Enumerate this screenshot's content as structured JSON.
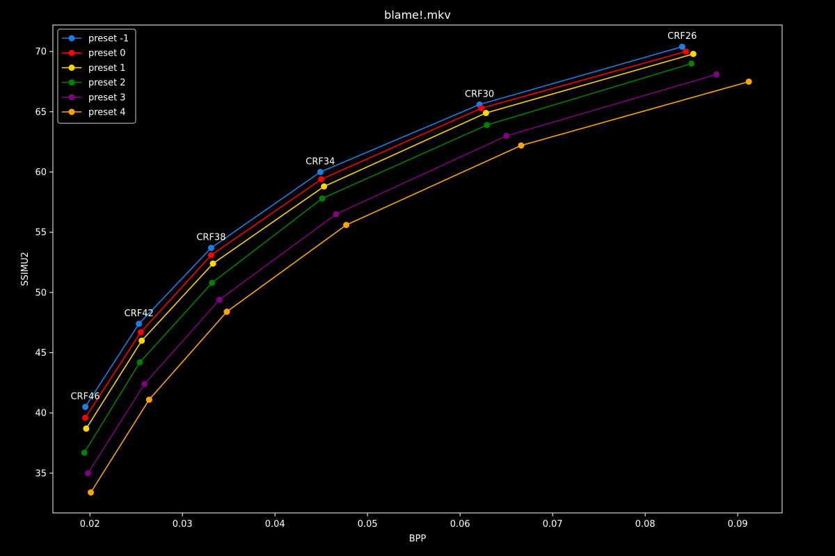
{
  "chart_data": {
    "type": "line",
    "title": "blame!.mkv",
    "xlabel": "BPP",
    "ylabel": "SSIMU2",
    "xlim": [
      0.016,
      0.0948
    ],
    "ylim": [
      31.7,
      72.2
    ],
    "xticks": [
      0.02,
      0.03,
      0.04,
      0.05,
      0.06,
      0.07,
      0.08,
      0.09
    ],
    "yticks": [
      35,
      40,
      45,
      50,
      55,
      60,
      65,
      70
    ],
    "grid": false,
    "legend_position": "top-left",
    "series": [
      {
        "name": "preset -1",
        "color": "#1a80e6",
        "points": [
          [
            0.0195,
            40.5
          ],
          [
            0.0253,
            47.4
          ],
          [
            0.0331,
            53.7
          ],
          [
            0.0449,
            60.0
          ],
          [
            0.0621,
            65.6
          ],
          [
            0.084,
            70.4
          ]
        ]
      },
      {
        "name": "preset 0",
        "color": "#ff0000",
        "points": [
          [
            0.0195,
            39.6
          ],
          [
            0.0255,
            46.7
          ],
          [
            0.0331,
            53.1
          ],
          [
            0.045,
            59.4
          ],
          [
            0.0623,
            65.3
          ],
          [
            0.0844,
            70.0
          ]
        ]
      },
      {
        "name": "preset 1",
        "color": "#ffd700",
        "points": [
          [
            0.0196,
            38.7
          ],
          [
            0.0256,
            46.0
          ],
          [
            0.0333,
            52.4
          ],
          [
            0.0453,
            58.8
          ],
          [
            0.0628,
            64.9
          ],
          [
            0.0852,
            69.8
          ]
        ]
      },
      {
        "name": "preset 2",
        "color": "#008000",
        "points": [
          [
            0.0194,
            36.7
          ],
          [
            0.0254,
            44.2
          ],
          [
            0.0332,
            50.8
          ],
          [
            0.0451,
            57.8
          ],
          [
            0.0629,
            63.9
          ],
          [
            0.085,
            69.0
          ]
        ]
      },
      {
        "name": "preset 3",
        "color": "#800080",
        "points": [
          [
            0.0198,
            35.0
          ],
          [
            0.0259,
            42.4
          ],
          [
            0.034,
            49.4
          ],
          [
            0.0466,
            56.5
          ],
          [
            0.065,
            63.0
          ],
          [
            0.0877,
            68.1
          ]
        ]
      },
      {
        "name": "preset 4",
        "color": "#ffa500",
        "points": [
          [
            0.0201,
            33.4
          ],
          [
            0.0264,
            41.1
          ],
          [
            0.0348,
            48.4
          ],
          [
            0.0477,
            55.6
          ],
          [
            0.0666,
            62.2
          ],
          [
            0.0912,
            67.5
          ]
        ]
      }
    ],
    "annotations": [
      {
        "text": "CRF46",
        "x": 0.0195,
        "y": 40.5
      },
      {
        "text": "CRF42",
        "x": 0.0253,
        "y": 47.4
      },
      {
        "text": "CRF38",
        "x": 0.0331,
        "y": 53.7
      },
      {
        "text": "CRF34",
        "x": 0.0449,
        "y": 60.0
      },
      {
        "text": "CRF30",
        "x": 0.0621,
        "y": 65.6
      },
      {
        "text": "CRF26",
        "x": 0.084,
        "y": 70.4
      }
    ]
  }
}
